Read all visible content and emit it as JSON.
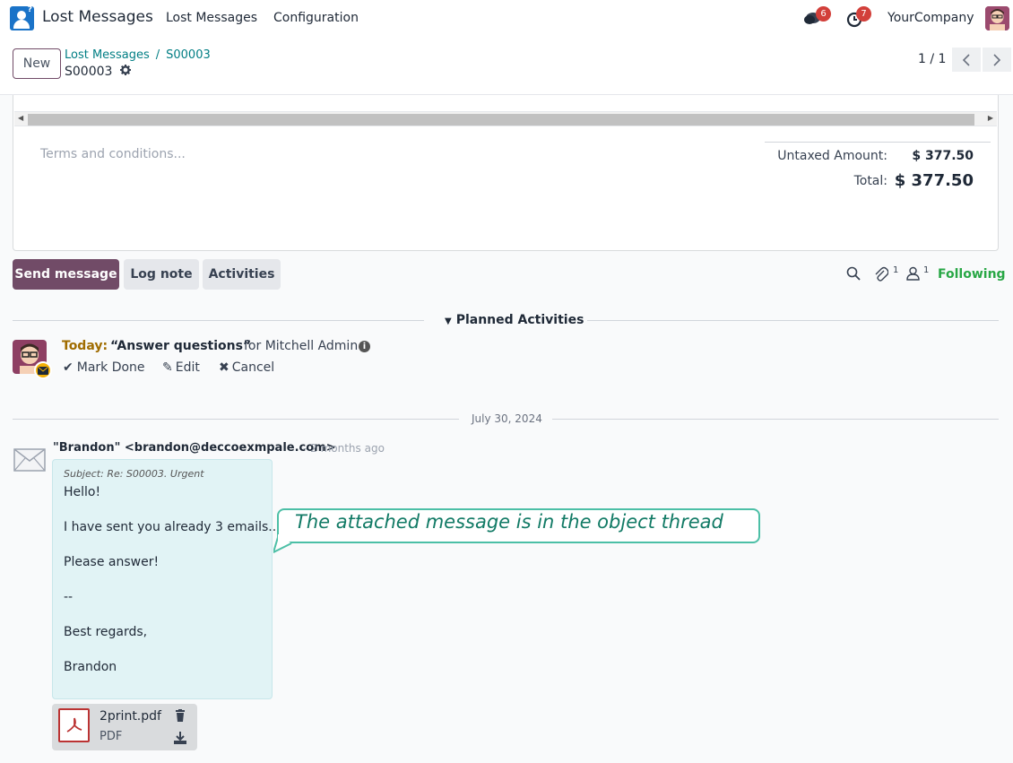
{
  "navbar": {
    "app_name": "Lost Messages",
    "menu": [
      "Lost Messages",
      "Configuration"
    ],
    "chat_count": "6",
    "activity_count": "7",
    "company": "YourCompany"
  },
  "control": {
    "new_label": "New",
    "breadcrumb_parent": "Lost Messages",
    "breadcrumb_current": "S00003",
    "record_name": "S00003",
    "pager": "1 / 1"
  },
  "form": {
    "terms_placeholder": "Terms and conditions...",
    "untaxed_label": "Untaxed Amount:",
    "untaxed_value": "$ 377.50",
    "total_label": "Total:",
    "total_value": "$ 377.50"
  },
  "chatter": {
    "send_message": "Send message",
    "log_note": "Log note",
    "activities": "Activities",
    "attachment_count": "1",
    "follower_count": "1",
    "following": "Following",
    "planned_title": "Planned Activities",
    "activity": {
      "when": "Today:",
      "summary": "“Answer questions”",
      "for": "for Mitchell Admin",
      "mark_done": "Mark Done",
      "edit": "Edit",
      "cancel": "Cancel"
    },
    "date_separator": "July 30, 2024",
    "message": {
      "author": "\"Brandon\" <brandon@deccoexmpale.com>",
      "date": "- 2 months ago",
      "subject": "Subject: Re: S00003. Urgent",
      "lines": [
        "Hello!",
        "I have sent you already 3 emails...",
        "Please answer!",
        "--",
        "Best regards,",
        "Brandon"
      ]
    },
    "attachment": {
      "name": "2print.pdf",
      "ext": "PDF"
    }
  },
  "callout": {
    "text": "The attached message is in the object thread"
  }
}
